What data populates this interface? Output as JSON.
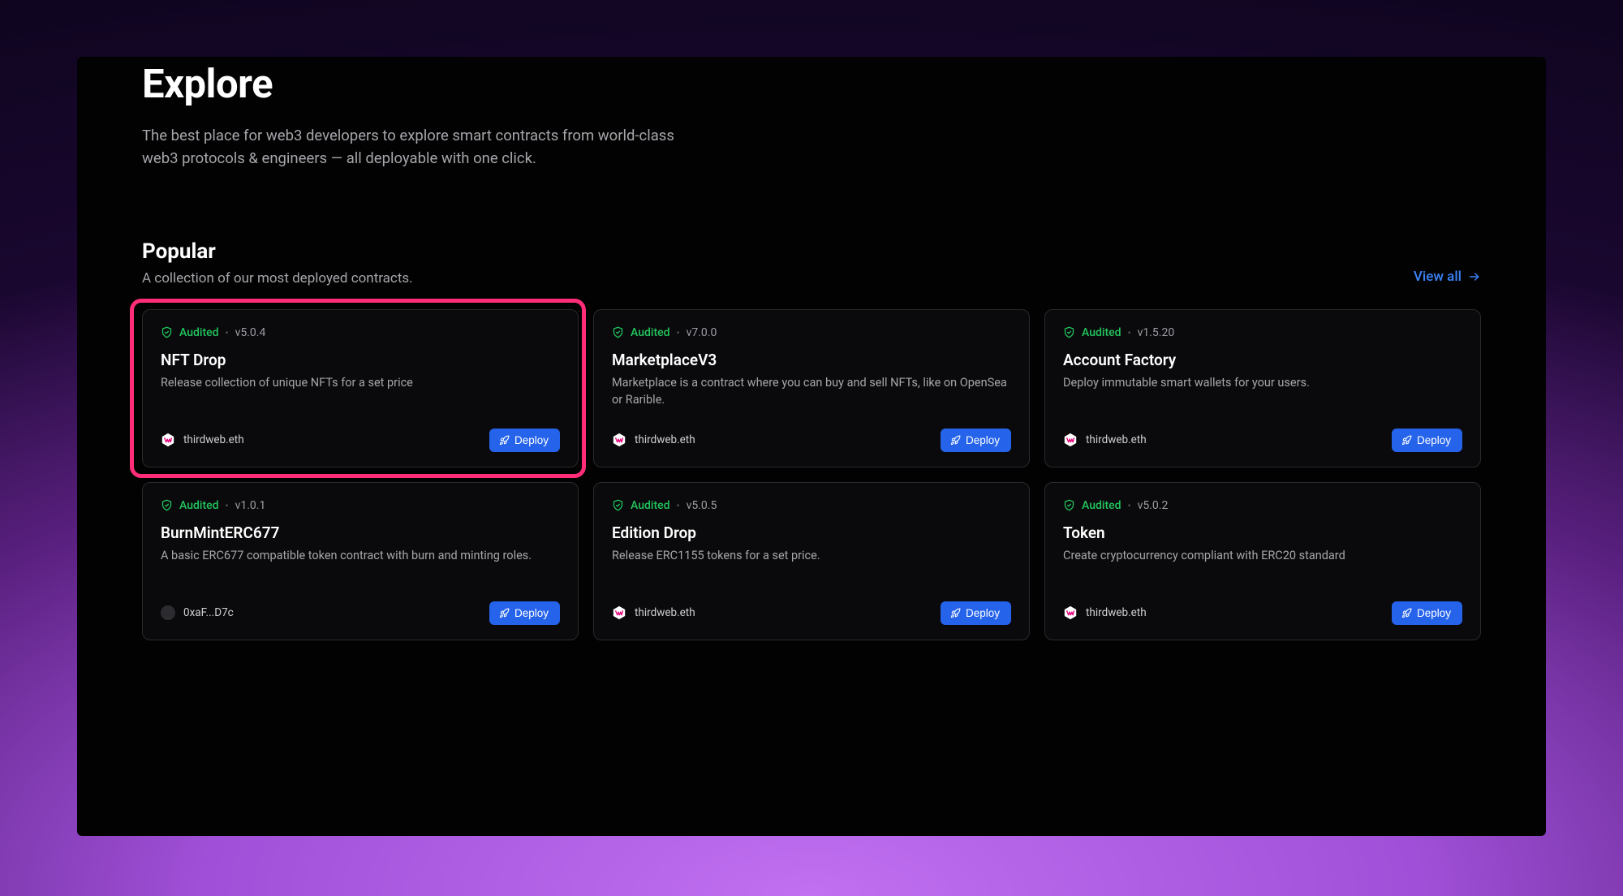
{
  "header": {
    "title": "Explore",
    "subtitle": "The best place for web3 developers to explore smart contracts from world-class web3 protocols & engineers — all deployable with one click."
  },
  "section": {
    "title": "Popular",
    "subtitle": "A collection of our most deployed contracts.",
    "view_all": "View all"
  },
  "labels": {
    "audited": "Audited",
    "deploy": "Deploy"
  },
  "cards": [
    {
      "version": "v5.0.4",
      "title": "NFT Drop",
      "desc": "Release collection of unique NFTs for a set price",
      "author": "thirdweb.eth",
      "highlighted": true,
      "avatar": "thirdweb"
    },
    {
      "version": "v7.0.0",
      "title": "MarketplaceV3",
      "desc": "Marketplace is a contract where you can buy and sell NFTs, like on OpenSea or Rarible.",
      "author": "thirdweb.eth",
      "highlighted": false,
      "avatar": "thirdweb"
    },
    {
      "version": "v1.5.20",
      "title": "Account Factory",
      "desc": "Deploy immutable smart wallets for your users.",
      "author": "thirdweb.eth",
      "highlighted": false,
      "avatar": "thirdweb"
    },
    {
      "version": "v1.0.1",
      "title": "BurnMintERC677",
      "desc": "A basic ERC677 compatible token contract with burn and minting roles.",
      "author": "0xaF...D7c",
      "highlighted": false,
      "avatar": "gray"
    },
    {
      "version": "v5.0.5",
      "title": "Edition Drop",
      "desc": "Release ERC1155 tokens for a set price.",
      "author": "thirdweb.eth",
      "highlighted": false,
      "avatar": "thirdweb"
    },
    {
      "version": "v5.0.2",
      "title": "Token",
      "desc": "Create cryptocurrency compliant with ERC20 standard",
      "author": "thirdweb.eth",
      "highlighted": false,
      "avatar": "thirdweb"
    }
  ]
}
